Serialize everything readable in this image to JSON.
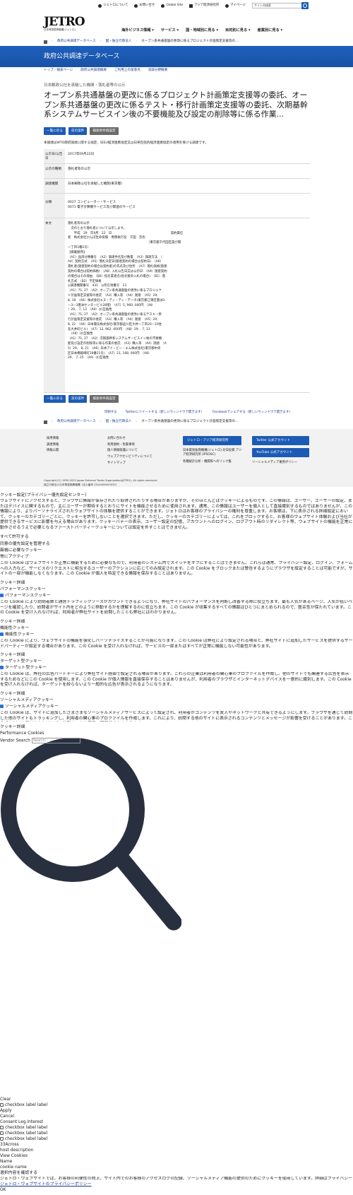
{
  "top_links": [
    "ジェトロについて",
    "お問い合せ",
    "Global Site",
    "アジア経済研究所",
    "マイページ",
    "サイト内検索"
  ],
  "logo": {
    "mark": "JETRO",
    "sub": "日本貿易振興機構(ジェトロ)"
  },
  "main_nav": [
    "海外ビジネス情報 ▾",
    "サービス ▾",
    "国・地域別に見る ▾",
    "目的別に見る ▾",
    "産業別に見る ▾"
  ],
  "breadcrumb": [
    "政府公共調達データベース",
    "国・独立行政法人",
    "オープン系共通基盤の更改に係るプロジェクト計画策定支援等の..."
  ],
  "band_title": "政府公共調達データベース",
  "sub_nav": [
    "トップ／検索ページ",
    "政府公共調達概要",
    "ご利用上の留意点",
    "収録分野概要"
  ],
  "category": "日本郵政公社を承継した機関・落札者等の公示",
  "page_title": "オープン系共通基盤の更改に係るプロジェクト計画策定支援等の委託、オープン系共通基盤の更改に係るテスト・移行計画策定支援等の委託、次期基幹系システムサービスイン後の不要機能及び設定の削除等に係る作業...",
  "buttons": [
    "一覧に戻る",
    "前の案件",
    "検索条件再設定"
  ],
  "note": "本調達はWTO政府調達に関する協定、日EU経済連携協定又は日英包括的経済連携協定の適用を受ける調達です。",
  "info_rows": [
    {
      "key": "公示日/公告日",
      "value": "2017年09月22日"
    },
    {
      "key": "公示の種類",
      "value": "落札者等の公示"
    },
    {
      "key": "調達機関",
      "value": "日本郵政公社を承継した機関(東京都)"
    },
    {
      "key": "分類",
      "value": "0027 コンピューター・サービス\n0071 電子計算機サービス及び関連のサービス"
    },
    {
      "key": "本文",
      "value": "落札者等の公示\n　次のとおり落札者について公示します。\n　　平成　29　年9月　22　日　　　　　　　　　　　　　　　　　　　契約責任\n者　株式会社かんぽ生命保険　専務執行役　千田　哲也\n　　　　　　　　　　　　　　　　　　　　　　　　　　（東京都千代田区霞が関\n一丁目3番2号）\n【掲載順序】\n（A1）品目分類番号　（A2）調達件名及び数量　（A3）調達方法　（\nA4）契約方式　（A5）落札決定日(随意契約の場合は契約日)　（A6）\n落札者(随意契約の場合は契約者)の氏名及び住所　（A7）落札価格(随意\n契約の場合は契約価格)　（A8）入札公告日又は公示日　（A9）随意契約\nの場合はその理由　（B0）指名業者名(指名競争入札の場合)　（B1）落\n札方式　（B2）予定価格\n◎調達機関番号　431　◎所在地番号　13\n（A1）71, 27　（A2）オープン系共通基盤の更改に係るプロジェク\nト計画策定支援等の委託　（A3）購入等　（A4）随意　（A5）29,\n8, 18　（A6）株式会社エヌ・ティ・ティ・データ(東京都江東区豊洲3\n—3—3豊洲センタービル28階)　（A7）5, 960, 000円　（A8\n）29,　7, 13　（A9）(ｵ)互換性\n（A1）71, 27　（A2）オープン系共通基盤の更改に係るテスト・移\n行計画策定支援等の委託　（A3）購入等　（A4）随意　（A5）29,\n8, 22　（A6）日本電気株式会社(東京都品川区大井一丁目20—10住\n友大井町ビル)　（A7）12, 962, 000円　（A8）29,　7, 13\n　（A9）(ｵ)互換性\n（A1）71, 27　（A2）次期基幹系システムサービスイン後の不要機\n能及び設定の削除等に係る作業の委託　（A3）購入等　（A4）随意　（A\n5）29,　8, 21　（A6）日本アイ・ビー・エム株式会社(東京都中央\n区日本橋箱崎町19番21号)　（A7）21, 168, 000円　（A8）\n29,　7, 25　（A9）(ｵ)互換性"
    }
  ],
  "share": [
    "印刷する",
    "Twitterにツイートする（新しいウィンドウで開きます）",
    "Facebookでシェアする（新しいウィンドウで開きます）"
  ],
  "footer": {
    "col1": [
      "採用情報",
      "調達情報",
      "情報公開"
    ],
    "col2": [
      "お問い合わせ",
      "利用規約・免責事項",
      "個人情報保護について",
      "ウェブアクセシビリティについて",
      "サイトマップ"
    ],
    "col3_box": "ジェトロ・アジア経済研究所",
    "col3": [
      "日本貿易振興機構(ジェトロ) 対日投資 アジア経済研究所 (IPSOSC)",
      "各種統計分析・機関等へのリンク集"
    ],
    "col4_boxes": [
      "Twitter 公式アカウント",
      "YouTube 公式アカウント"
    ],
    "col4": "ソーシャルメディア運用ポリシー",
    "copy1": "Copyright (C) 1995-2022 Japan External Trade Organization(JETRO). All rights reserved.",
    "copy2": "独立行政法人日本貿易振興機構（法人番号 2010405003032）"
  },
  "cookie": {
    "title": "クッキー設定(プライバシー優先設定センター)",
    "intro": "ウェブサイトにアクセスすると、ブラウザに情報が保存されたり取得されたりする場合がありますが、そのほとんどはクッキーによるものです。この情報は、ユーザー、ユーザーの設定、またはデバイスに関するもので、主にユーザーが期待するとおりにサイトを機能させるために使用されます。通常、この情報はユーザーを個人として直接識別するものではありませんが、この情報により、よりパーソナライズされたウェブサイトの体験を提供することができます。ジェトロはお客様のプライバシーの権利を尊重します。お客様は、下に表示される詳細設定において、クッキーのカテゴリーごとに、クッキーを許可しないことを選択できます。ただし、クッキーのカテゴリーによっては、これをブロックすると、お客様のウェブサイト体験および当社が提供できるサービスに影響を与える場合があります。クッキーバナーの表示、ユーザー設定の記憶、アカウントへのログイン、ログアウト時のリダイレクト等、ウェブサイトの機能を正常に動作させるうえで必要となるファーストパーティークッキーについては設定を外すことはできません。",
    "allow_all": "すべて許可する",
    "manage": "同意の優先設定を管理する",
    "sec_strict": "厳格に必要なクッキー",
    "always_active": "常にアクティブ",
    "strict_desc": "この Cookie はウェブサイトが正常に機能するために必要なもので、利用者のシステム内でスイッチをオフにすることはできません。これらは通常、プライバシー設定、ログイン、フォームへの入力など、サービスのリクエストに相当するユーザーのアクションに応じてのみ設定されます。この Cookie をブロックまたは警告するようにブラウザを設定することは可能ですが、サイトの一部が機能しなくなります。この Cookie が個人を特定できる情報を保存することはありません。",
    "details": "クッキー詳細",
    "sec_perf": "パフォーマンスクッキー",
    "perf_label": "パフォーマンスクッキー",
    "perf_desc": "この Cookie により訪問者数と通信トラフィックソースがカウントできるようになり、弊社サイトのパフォーマンスを判断し改善する際に役立ちます。最も人気があるページ、人気が低いページを確認したり、訪問者がサイト内をどのように移動するかを理解するのに役立ちます。この Cookie が収集するすべての情報はひとつにまとめられるので、匿名性が保たれています。この Cookie を受け入れなければ、利用者が弊社サイトを訪問したことも弊社にはわかりません。",
    "sec_func": "機能性クッキー",
    "func_label": "機能性クッキー",
    "func_desc": "この Cookie により、ウェブサイトの機能を強化しパーソナライズすることが可能になります。この Cookie は弊社により設定される場合と、弊社サイトに追加したサービスを提供するサードパーティーが設定する場合があります。この Cookie を受け入れなければ、サービスの一部またはすべてが正常に機能しない可能性があります。",
    "sec_target": "ターゲット型クッキー",
    "target_label": "ターゲット型クッキー",
    "target_desc": "この Cookie は、弊社の広告パートナーにより弊社サイト経由で設定される場合があります。これらの企業は利用者の関心事のプロファイルを作成し、他のサイトでも関連する広告を表示するためなどにこの Cookie を使用します。この Cookie が個人情報を直接保存することはありませんが、利用者のブラウザとインターネットデバイスを一意的に識別します。この Cookie を受け入れなければ、ターゲットを絞らないより一般的な広告が表示されるようになります。",
    "sec_social": "ソーシャルメディアクッキー",
    "social_label": "ソーシャルメディアクッキー",
    "social_desc": "この Cookie は、サイトに追加したさまざまなソーシャルメディアサービスによって設定され、利用者がコンテンツを友人やネットワークと共有できるようにします。ブラウザを通じて訪問した他のサイトもトラッキングし、利用者の関心事のプロファイルを作成します。これにより、訪問する他のサイトに表示されるコンテンツとメッセージが影響を受けることがあります。この Cookie を受け入れなければ、共有ツールを使用・閲覧できなくなります。",
    "perf_title": "Performance Cookies",
    "vendor_search_label": "Vendor Search",
    "vendor_search_placeholder": "Search...",
    "clear": "Clear",
    "checkbox_label": "checkbox label label",
    "apply": "Apply",
    "cancel": "Cancel",
    "leg_interest": "Consent Leg.Interest",
    "across": "33Across",
    "host_desc": "host description",
    "view_cookies": "View Cookies",
    "name": "Name",
    "cookie_name": "cookie name",
    "confirm": "選択内容を確認する",
    "footer_text": "ジェトロ・ウェブサイトでは、お客様の利便性の向上、サイト内でのお客様のアクセスログの記録、ソーシャルメディア機能の提供のためにクッキーを使用しています。詳細はプライバシー・ポリシーをご参照ください。",
    "policy_link": "ジェトロ・ウェブサイトのプライバシーポリシー",
    "ok": "OK"
  }
}
